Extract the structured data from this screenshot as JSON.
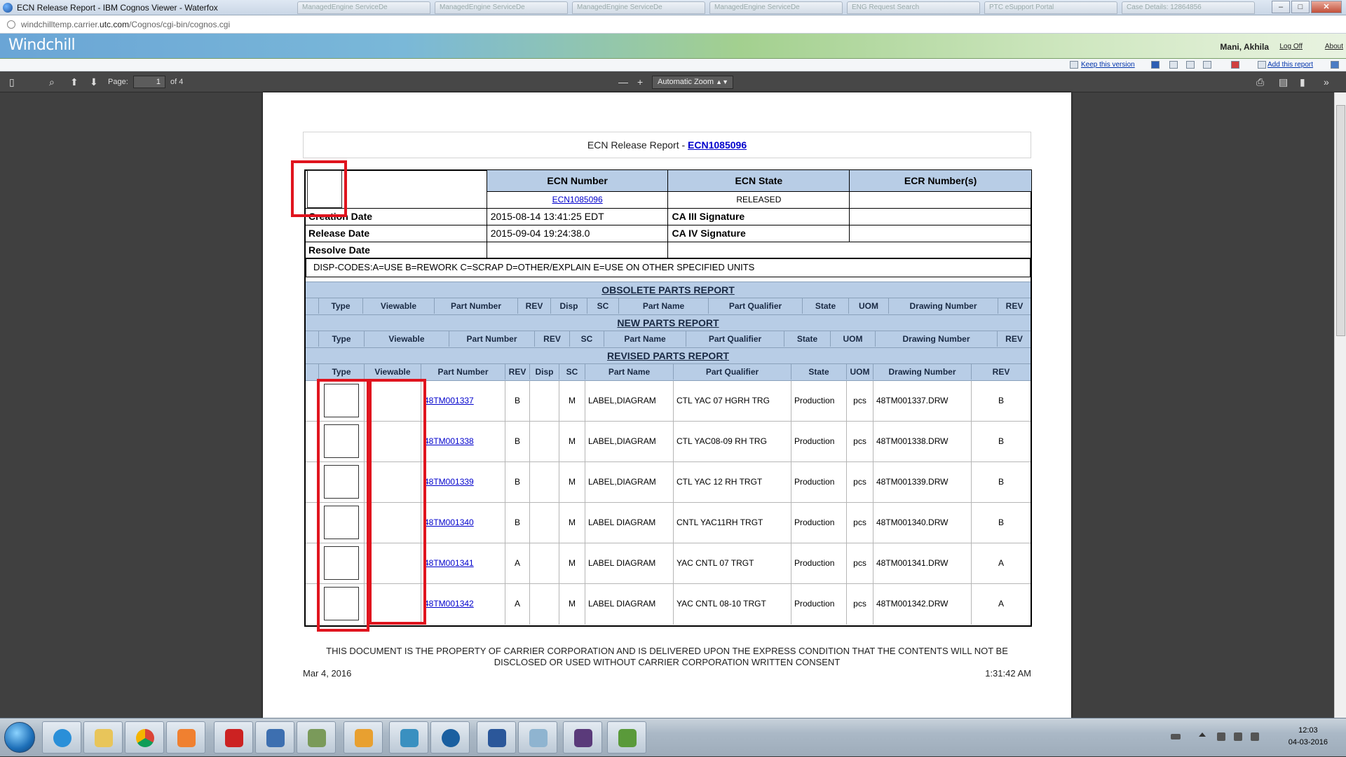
{
  "window": {
    "title": "ECN Release Report - IBM Cognos Viewer - Waterfox",
    "tabs": [
      "ManagedEngine ServiceDe",
      "ManagedEngine ServiceDe",
      "ManagedEngine ServiceDe",
      "ManagedEngine ServiceDe",
      "ENG Request Search",
      "PTC eSupport Portal",
      "Case Details: 12864856"
    ],
    "controls": {
      "minimize": "–",
      "maximize": "□",
      "close": "✕"
    }
  },
  "address_bar": {
    "url_prefix": "windchilltemp.carrier.",
    "url_domain": "utc.com",
    "url_path": "/Cognos/cgi-bin/cognos.cgi"
  },
  "windchill": {
    "logo": "Windchill",
    "user": "Mani, Akhila",
    "log_off": "Log Off",
    "about": "About",
    "toolbar": {
      "keep_version": "Keep this version",
      "add_report": "Add this report"
    }
  },
  "pdf_toolbar": {
    "page_label": "Page:",
    "page_number": "1",
    "page_of": "of 4",
    "zoom": "Automatic Zoom",
    "zoom_out": "—",
    "zoom_in": "+"
  },
  "report": {
    "title_prefix": "ECN Release Report - ",
    "ecn_link": "ECN1085096",
    "header_cols": [
      "ECN Number",
      "ECN State",
      "ECR Number(s)"
    ],
    "ecn_number": "ECN1085096",
    "ecn_state": "RELEASED",
    "ecr_numbers": "",
    "creation_date_label": "Creation Date",
    "creation_date": "2015-08-14 13:41:25 EDT",
    "release_date_label": "Release Date",
    "release_date": "2015-09-04 19:24:38.0",
    "resolve_date_label": "Resolve Date",
    "resolve_date": "",
    "ca3_label": "CA III Signature",
    "ca4_label": "CA IV Signature",
    "disp_codes": "DISP-CODES:A=USE   B=REWORK  C=SCRAP  D=OTHER/EXPLAIN  E=USE ON OTHER SPECIFIED UNITS",
    "obsolete_title": "OBSOLETE PARTS REPORT",
    "new_title": "NEW PARTS REPORT",
    "revised_title": "REVISED PARTS REPORT",
    "obsolete_cols": [
      "Type",
      "Viewable",
      "Part Number",
      "REV",
      "Disp",
      "SC",
      "Part Name",
      "Part Qualifier",
      "State",
      "UOM",
      "Drawing Number",
      "REV"
    ],
    "new_cols": [
      "Type",
      "Viewable",
      "Part Number",
      "REV",
      "SC",
      "Part Name",
      "Part Qualifier",
      "State",
      "UOM",
      "Drawing Number",
      "REV"
    ],
    "revised_cols": [
      "Type",
      "Viewable",
      "Part Number",
      "REV",
      "Disp",
      "SC",
      "Part Name",
      "Part Qualifier",
      "State",
      "UOM",
      "Drawing Number",
      "REV"
    ],
    "revised_rows": [
      {
        "part": "48TM001337",
        "rev": "B",
        "disp": "",
        "sc": "M",
        "name": "LABEL,DIAGRAM",
        "qual": "CTL YAC 07 HGRH TRG",
        "state": "Production",
        "uom": "pcs",
        "dwg": "48TM001337.DRW",
        "rev2": "B"
      },
      {
        "part": "48TM001338",
        "rev": "B",
        "disp": "",
        "sc": "M",
        "name": "LABEL,DIAGRAM",
        "qual": "CTL YAC08-09 RH TRG",
        "state": "Production",
        "uom": "pcs",
        "dwg": "48TM001338.DRW",
        "rev2": "B"
      },
      {
        "part": "48TM001339",
        "rev": "B",
        "disp": "",
        "sc": "M",
        "name": "LABEL,DIAGRAM",
        "qual": "CTL YAC 12 RH TRGT",
        "state": "Production",
        "uom": "pcs",
        "dwg": "48TM001339.DRW",
        "rev2": "B"
      },
      {
        "part": "48TM001340",
        "rev": "B",
        "disp": "",
        "sc": "M",
        "name": "LABEL DIAGRAM",
        "qual": "CNTL YAC11RH TRGT",
        "state": "Production",
        "uom": "pcs",
        "dwg": "48TM001340.DRW",
        "rev2": "B"
      },
      {
        "part": "48TM001341",
        "rev": "A",
        "disp": "",
        "sc": "M",
        "name": "LABEL DIAGRAM",
        "qual": "YAC CNTL 07 TRGT",
        "state": "Production",
        "uom": "pcs",
        "dwg": "48TM001341.DRW",
        "rev2": "A"
      },
      {
        "part": "48TM001342",
        "rev": "A",
        "disp": "",
        "sc": "M",
        "name": "LABEL DIAGRAM",
        "qual": "YAC CNTL 08-10 TRGT",
        "state": "Production",
        "uom": "pcs",
        "dwg": "48TM001342.DRW",
        "rev2": "A"
      }
    ],
    "footer_note_1": "THIS DOCUMENT IS THE PROPERTY OF CARRIER CORPORATION AND IS DELIVERED UPON THE EXPRESS CONDITION THAT THE CONTENTS WILL NOT BE",
    "footer_note_2": "DISCLOSED OR USED WITHOUT CARRIER CORPORATION WRITTEN CONSENT",
    "footer_date": "Mar 4, 2016",
    "footer_time": "1:31:42 AM"
  },
  "taskbar": {
    "apps": [
      "internet-explorer",
      "file-explorer",
      "chrome",
      "media-player",
      "filezilla",
      "network-tool",
      "database-tool",
      "outlook",
      "remote-desktop",
      "waterfox",
      "word",
      "notepad",
      "java-ee-ide",
      "project-tool"
    ],
    "time": "12:03",
    "date": "04-03-2016"
  },
  "colors": {
    "header_blue": "#b8cde6",
    "link": "#0000cc",
    "annotation_red": "#e0141e"
  }
}
